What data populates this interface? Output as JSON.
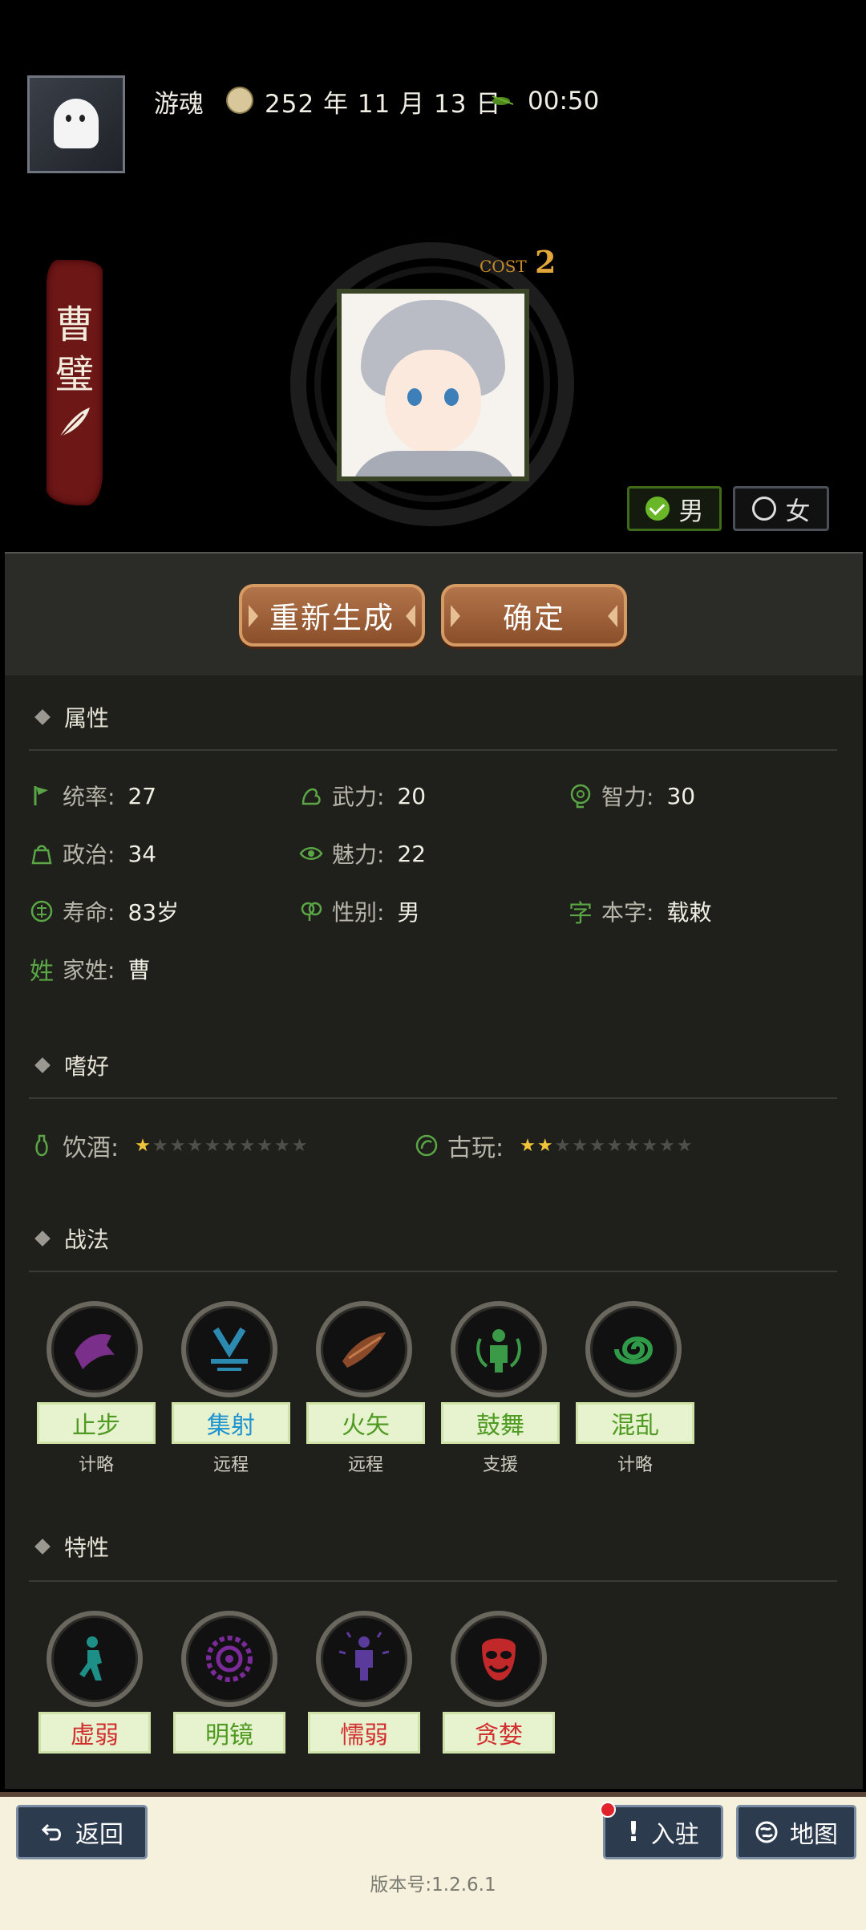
{
  "header": {
    "player_name": "游魂",
    "date": "252 年 11 月 13 日",
    "time": "00:50"
  },
  "hero": {
    "name": "曹璧",
    "cost_label": "COST",
    "cost_value": "2",
    "gender_options": [
      "男",
      "女"
    ],
    "selected_gender": "男"
  },
  "actions": {
    "regenerate_label": "重新生成",
    "confirm_label": "确定"
  },
  "attributes": {
    "section_title": "属性",
    "items": [
      {
        "label": "统率:",
        "value": "27",
        "icon": "flag-icon"
      },
      {
        "label": "武力:",
        "value": "20",
        "icon": "arm-icon"
      },
      {
        "label": "智力:",
        "value": "30",
        "icon": "brain-icon"
      },
      {
        "label": "政治:",
        "value": "34",
        "icon": "bag-icon"
      },
      {
        "label": "魅力:",
        "value": "22",
        "icon": "eye-icon"
      },
      {
        "label": "寿命:",
        "value": "83岁",
        "icon": "lifespan-icon"
      },
      {
        "label": "性别:",
        "value": "男",
        "icon": "gender-icon"
      },
      {
        "label": "本字:",
        "value": "载敕",
        "icon": "zi-icon",
        "icon_char": "字"
      },
      {
        "label": "家姓:",
        "value": "曹",
        "icon": "xing-icon",
        "icon_char": "姓"
      }
    ]
  },
  "hobbies": {
    "section_title": "嗜好",
    "items": [
      {
        "label": "饮酒:",
        "stars_on": 1,
        "stars_total": 10,
        "icon": "wine-icon"
      },
      {
        "label": "古玩:",
        "stars_on": 2,
        "stars_total": 10,
        "icon": "antique-icon"
      }
    ]
  },
  "tactics": {
    "section_title": "战法",
    "items": [
      {
        "name": "止步",
        "type": "计略",
        "name_color": "#4f9a22",
        "icon": "halt-icon",
        "icon_color": "#7a2f8a"
      },
      {
        "name": "集射",
        "type": "远程",
        "name_color": "#1e93d0",
        "icon": "volley-icon",
        "icon_color": "#2c6e8c"
      },
      {
        "name": "火矢",
        "type": "远程",
        "name_color": "#4f9a22",
        "icon": "fire-arrow-icon",
        "icon_color": "#8a4a2a"
      },
      {
        "name": "鼓舞",
        "type": "支援",
        "name_color": "#4f9a22",
        "icon": "inspire-icon",
        "icon_color": "#2f7a3a"
      },
      {
        "name": "混乱",
        "type": "计略",
        "name_color": "#4f9a22",
        "icon": "chaos-icon",
        "icon_color": "#2f8a3a"
      }
    ]
  },
  "traits": {
    "section_title": "特性",
    "items": [
      {
        "name": "虚弱",
        "name_color": "#d23030",
        "icon": "weak-icon",
        "icon_color": "#1e8f86"
      },
      {
        "name": "明镜",
        "name_color": "#4f9a22",
        "icon": "mirror-icon",
        "icon_color": "#7b2a9a"
      },
      {
        "name": "懦弱",
        "name_color": "#d23030",
        "icon": "coward-icon",
        "icon_color": "#5a3a9a"
      },
      {
        "name": "贪婪",
        "name_color": "#d23030",
        "icon": "greed-icon",
        "icon_color": "#c0282a"
      }
    ]
  },
  "footer": {
    "back_label": "返回",
    "station_label": "入驻",
    "map_label": "地图",
    "version": "版本号:1.2.6.1"
  }
}
